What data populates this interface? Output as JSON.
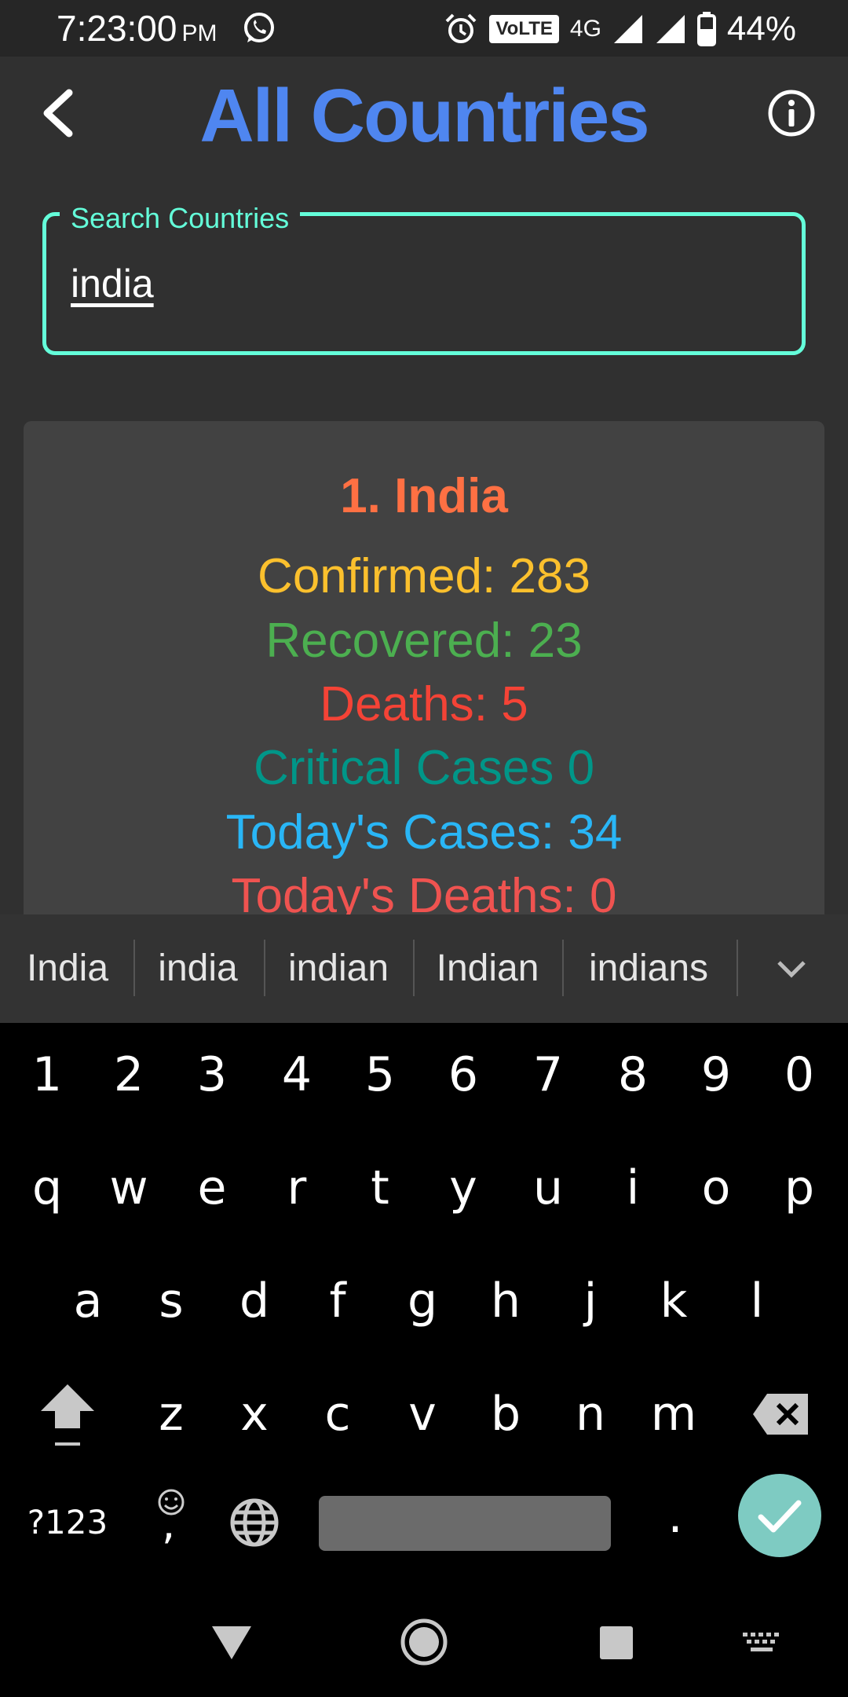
{
  "status_bar": {
    "time": "7:23:00",
    "ampm": "PM",
    "volte": "VoLTE",
    "network": "4G",
    "battery": "44%",
    "icons": [
      "whatsapp-icon",
      "alarm-icon",
      "signal-icon",
      "signal-icon",
      "battery-icon"
    ]
  },
  "header": {
    "title": "All Countries",
    "back_icon": "back-arrow-icon",
    "info_icon": "info-icon"
  },
  "search": {
    "label": "Search Countries",
    "value": "india"
  },
  "country_card": {
    "title": "1.  India",
    "confirmed": "Confirmed: 283",
    "recovered": "Recovered: 23",
    "deaths": "Deaths: 5",
    "critical": "Critical Cases 0",
    "today_cases": "Today's Cases: 34",
    "today_deaths": "Today's Deaths: 0"
  },
  "keyboard": {
    "suggestions": [
      "India",
      "india",
      "indian",
      "Indian",
      "indians"
    ],
    "row_numbers": [
      "1",
      "2",
      "3",
      "4",
      "5",
      "6",
      "7",
      "8",
      "9",
      "0"
    ],
    "row1": [
      "q",
      "w",
      "e",
      "r",
      "t",
      "y",
      "u",
      "i",
      "o",
      "p"
    ],
    "row2": [
      "a",
      "s",
      "d",
      "f",
      "g",
      "h",
      "j",
      "k",
      "l"
    ],
    "row3": [
      "z",
      "x",
      "c",
      "v",
      "b",
      "n",
      "m"
    ],
    "symbols_key": "?123",
    "comma_key": ",",
    "period_key": ".",
    "accent_color": "#7ecbc2"
  },
  "colors": {
    "title_blue": "#4f86f0",
    "search_accent": "#64ffda",
    "country_name": "#ff7043",
    "confirmed": "#fbc02d",
    "recovered": "#4caf50",
    "deaths": "#f44336",
    "critical": "#009688",
    "today_cases": "#29b6f6",
    "today_deaths": "#ef5350"
  }
}
